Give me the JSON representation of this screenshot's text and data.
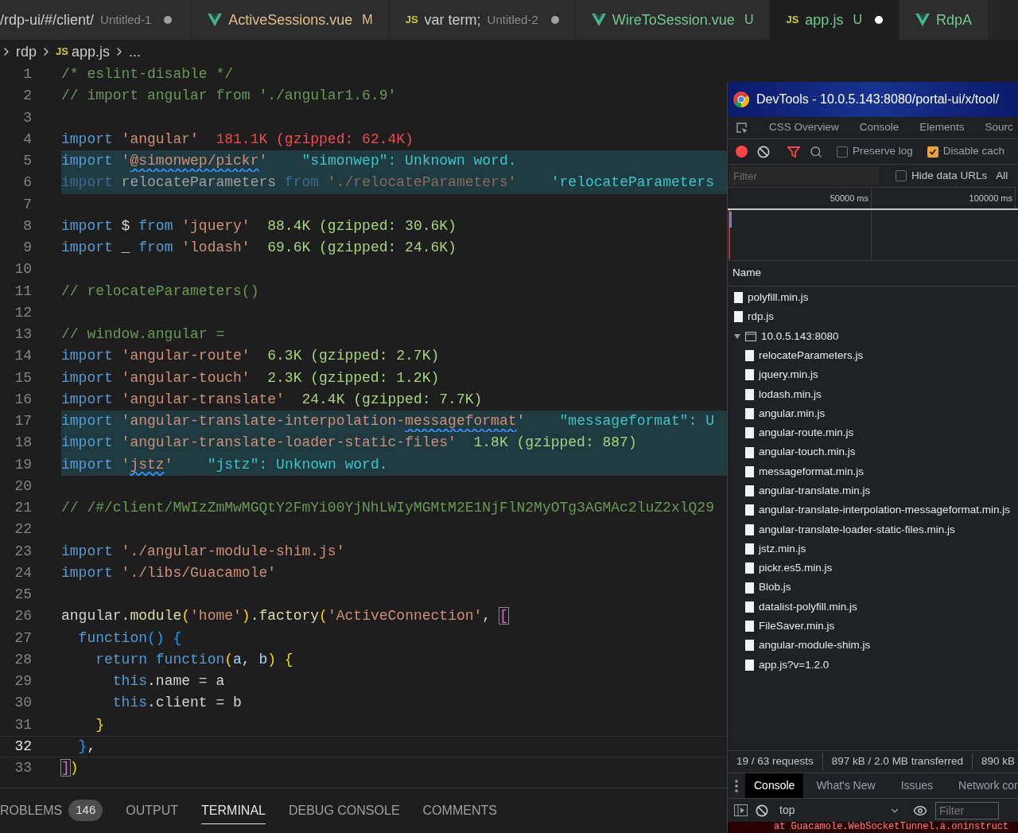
{
  "editor_tabs": [
    {
      "kind": "plain",
      "label": "/rdp-ui/#/client/",
      "detail": "Untitled-1",
      "dirty": true,
      "selected": false,
      "color": "#cccccc"
    },
    {
      "kind": "vue",
      "label": "ActiveSessions.vue",
      "status": "M",
      "dirty": false,
      "selected": false,
      "color": "#e2c08d"
    },
    {
      "kind": "js",
      "icon_text": "JS",
      "label": "var term;",
      "detail": "Untitled-2",
      "dirty": true,
      "selected": false,
      "color": "#cccccc"
    },
    {
      "kind": "vue",
      "label": "WireToSession.vue",
      "status": "U",
      "dirty": false,
      "selected": false,
      "color": "#73c991"
    },
    {
      "kind": "js",
      "icon_text": "JS",
      "label": "app.js",
      "status": "U",
      "dirty": true,
      "selected": true,
      "color": "#73c991"
    },
    {
      "kind": "vue",
      "label": "RdpA",
      "dirty": false,
      "selected": false,
      "color": "#73c991"
    }
  ],
  "breadcrumbs": [
    {
      "text": "rdp"
    },
    {
      "icon_text": "JS",
      "text": "app.js"
    },
    {
      "text": "..."
    }
  ],
  "code_lines": [
    {
      "number": "1",
      "highlighted": false,
      "current": false,
      "tokens": [
        {
          "kind": "cm",
          "text": "/* eslint-disable */"
        }
      ]
    },
    {
      "number": "2",
      "highlighted": false,
      "current": false,
      "tokens": [
        {
          "kind": "cm",
          "text": "// import angular from './angular1.6.9'"
        }
      ]
    },
    {
      "number": "3",
      "highlighted": false,
      "current": false
    },
    {
      "number": "4",
      "highlighted": false,
      "current": false,
      "tokens": [
        {
          "kind": "kw",
          "text": "import"
        },
        {
          "kind": "str",
          "text": " 'angular'"
        },
        {
          "kind": "warn",
          "text": "  181.1K (gzipped: 62.4K)"
        }
      ]
    },
    {
      "number": "5",
      "highlighted": true,
      "current": false,
      "tokens": [
        {
          "kind": "kw",
          "text": "import"
        },
        {
          "kind": "str",
          "text": " '"
        },
        {
          "kind": "str",
          "text": "@simonwep/pickr",
          "squiggle": true
        },
        {
          "kind": "str",
          "text": "'"
        },
        {
          "kind": "hint",
          "text": "    \"simonwep\": Unknown word."
        }
      ]
    },
    {
      "number": "6",
      "highlighted": true,
      "current": false,
      "tokens": [
        {
          "kind": "kw_dim",
          "text": "import"
        },
        {
          "kind": "plain_dim",
          "text": " relocateParameters"
        },
        {
          "kind": "kw_dim",
          "text": " from"
        },
        {
          "kind": "str_dim",
          "text": " './relocateParameters'"
        },
        {
          "kind": "hint",
          "text": "    'relocateParameters"
        }
      ]
    },
    {
      "number": "7",
      "highlighted": false,
      "current": false
    },
    {
      "number": "8",
      "highlighted": false,
      "current": false,
      "tokens": [
        {
          "kind": "kw",
          "text": "import"
        },
        {
          "kind": "plain",
          "text": " $"
        },
        {
          "kind": "kw",
          "text": " from"
        },
        {
          "kind": "str",
          "text": " 'jquery'"
        },
        {
          "kind": "size",
          "text": "  88.4K (gzipped: 30.6K)"
        }
      ]
    },
    {
      "number": "9",
      "highlighted": false,
      "current": false,
      "tokens": [
        {
          "kind": "kw",
          "text": "import"
        },
        {
          "kind": "plain",
          "text": " _"
        },
        {
          "kind": "kw",
          "text": " from"
        },
        {
          "kind": "str",
          "text": " 'lodash'"
        },
        {
          "kind": "size",
          "text": "  69.6K (gzipped: 24.6K)"
        }
      ]
    },
    {
      "number": "10",
      "highlighted": false,
      "current": false
    },
    {
      "number": "11",
      "highlighted": false,
      "current": false,
      "tokens": [
        {
          "kind": "cm",
          "text": "// relocateParameters()"
        }
      ]
    },
    {
      "number": "12",
      "highlighted": false,
      "current": false
    },
    {
      "number": "13",
      "highlighted": false,
      "current": false,
      "tokens": [
        {
          "kind": "cm",
          "text": "// window.angular ="
        }
      ]
    },
    {
      "number": "14",
      "highlighted": false,
      "current": false,
      "tokens": [
        {
          "kind": "kw",
          "text": "import"
        },
        {
          "kind": "str",
          "text": " 'angular-route'"
        },
        {
          "kind": "size",
          "text": "  6.3K (gzipped: 2.7K)"
        }
      ]
    },
    {
      "number": "15",
      "highlighted": false,
      "current": false,
      "tokens": [
        {
          "kind": "kw",
          "text": "import"
        },
        {
          "kind": "str",
          "text": " 'angular-touch'"
        },
        {
          "kind": "size",
          "text": "  2.3K (gzipped: 1.2K)"
        }
      ]
    },
    {
      "number": "16",
      "highlighted": false,
      "current": false,
      "tokens": [
        {
          "kind": "kw",
          "text": "import"
        },
        {
          "kind": "str",
          "text": " 'angular-translate'"
        },
        {
          "kind": "size",
          "text": "  24.4K (gzipped: 7.7K)"
        }
      ]
    },
    {
      "number": "17",
      "highlighted": true,
      "current": false,
      "tokens": [
        {
          "kind": "kw",
          "text": "import"
        },
        {
          "kind": "str",
          "text": " 'angular-translate-interpolation-"
        },
        {
          "kind": "str",
          "text": "messageformat",
          "squiggle": true
        },
        {
          "kind": "str",
          "text": "'"
        },
        {
          "kind": "hint",
          "text": "    \"messageformat\": U"
        }
      ]
    },
    {
      "number": "18",
      "highlighted": true,
      "current": false,
      "tokens": [
        {
          "kind": "kw",
          "text": "import"
        },
        {
          "kind": "str",
          "text": " 'angular-translate-loader-static-files'"
        },
        {
          "kind": "size",
          "text": "  1.8K (gzipped: 887)"
        }
      ]
    },
    {
      "number": "19",
      "highlighted": true,
      "current": false,
      "tokens": [
        {
          "kind": "kw",
          "text": "import"
        },
        {
          "kind": "str",
          "text": " '"
        },
        {
          "kind": "str",
          "text": "jstz",
          "squiggle": true
        },
        {
          "kind": "str",
          "text": "'"
        },
        {
          "kind": "hint",
          "text": "    \"jstz\": Unknown word."
        }
      ]
    },
    {
      "number": "20",
      "highlighted": false,
      "current": false
    },
    {
      "number": "21",
      "highlighted": false,
      "current": false,
      "tokens": [
        {
          "kind": "cm",
          "text": "// /#/client/MWIzZmMwMGQtY2FmYi00YjNhLWIyMGMtM2E1NjFlN2MyOTg3AGMAc2luZ2xlQ29"
        }
      ]
    },
    {
      "number": "22",
      "highlighted": false,
      "current": false
    },
    {
      "number": "23",
      "highlighted": false,
      "current": false,
      "tokens": [
        {
          "kind": "kw",
          "text": "import"
        },
        {
          "kind": "str",
          "text": " './angular-module-shim.js'"
        }
      ]
    },
    {
      "number": "24",
      "highlighted": false,
      "current": false,
      "tokens": [
        {
          "kind": "kw",
          "text": "import"
        },
        {
          "kind": "str",
          "text": " './libs/Guacamole'"
        }
      ]
    },
    {
      "number": "25",
      "highlighted": false,
      "current": false
    },
    {
      "number": "26",
      "highlighted": false,
      "current": false,
      "tokens": [
        {
          "kind": "plain",
          "text": "angular."
        },
        {
          "kind": "fn",
          "text": "module"
        },
        {
          "kind": "b1",
          "text": "("
        },
        {
          "kind": "str",
          "text": "'home'"
        },
        {
          "kind": "b1",
          "text": ")"
        },
        {
          "kind": "plain",
          "text": "."
        },
        {
          "kind": "fn",
          "text": "factory"
        },
        {
          "kind": "b1",
          "text": "("
        },
        {
          "kind": "str",
          "text": "'ActiveConnection'"
        },
        {
          "kind": "plain",
          "text": ", "
        },
        {
          "kind": "b2",
          "text": "[",
          "boxed": true
        }
      ]
    },
    {
      "number": "27",
      "highlighted": false,
      "current": false,
      "tokens": [
        {
          "kind": "kw",
          "text": "  function"
        },
        {
          "kind": "b3",
          "text": "() {"
        }
      ]
    },
    {
      "number": "28",
      "highlighted": false,
      "current": false,
      "tokens": [
        {
          "kind": "kw",
          "text": "    return function"
        },
        {
          "kind": "b1",
          "text": "("
        },
        {
          "kind": "var",
          "text": "a, b"
        },
        {
          "kind": "b1",
          "text": ") {"
        }
      ]
    },
    {
      "number": "29",
      "highlighted": false,
      "current": false,
      "tokens": [
        {
          "kind": "kw",
          "text": "      this"
        },
        {
          "kind": "plain",
          "text": ".name = a"
        }
      ]
    },
    {
      "number": "30",
      "highlighted": false,
      "current": false,
      "tokens": [
        {
          "kind": "kw",
          "text": "      this"
        },
        {
          "kind": "plain",
          "text": ".client = b"
        }
      ]
    },
    {
      "number": "31",
      "highlighted": false,
      "current": false,
      "tokens": [
        {
          "kind": "b1",
          "text": "    }"
        }
      ]
    },
    {
      "number": "32",
      "highlighted": false,
      "current": true,
      "tokens": [
        {
          "kind": "b3",
          "text": "  }"
        },
        {
          "kind": "plain",
          "text": ","
        }
      ]
    },
    {
      "number": "33",
      "highlighted": false,
      "current": false,
      "tokens": [
        {
          "kind": "b2",
          "text": "]",
          "boxed": true
        },
        {
          "kind": "b1",
          "text": ")"
        }
      ]
    }
  ],
  "panel_tabs": [
    {
      "label": "ROBLEMS",
      "badge": "146",
      "selected": false
    },
    {
      "label": "OUTPUT",
      "selected": false
    },
    {
      "label": "TERMINAL",
      "selected": true
    },
    {
      "label": "DEBUG CONSOLE",
      "selected": false
    },
    {
      "label": "COMMENTS",
      "selected": false
    }
  ],
  "devtools": {
    "title": "DevTools - 10.0.5.143:8080/portal-ui/x/tool/",
    "tabs": [
      {
        "label": "CSS Overview",
        "selected": false
      },
      {
        "label": "Console",
        "selected": false
      },
      {
        "label": "Elements",
        "selected": false
      },
      {
        "label": "Sourc",
        "selected": false
      }
    ],
    "recording": true,
    "filter_active": true,
    "checkboxes": [
      {
        "label": "Preserve log",
        "checked": false
      },
      {
        "label": "Disable cach",
        "checked": true
      }
    ],
    "filter": {
      "placeholder": "Filter",
      "hide_data_urls": {
        "label": "Hide data URLs",
        "checked": false
      },
      "type_button": "All"
    },
    "timeline": {
      "ticks": [
        "50000 ms",
        "100000 ms"
      ]
    },
    "requests": {
      "column": "Name",
      "items": [
        {
          "kind": "file",
          "name": "polyfill.min.js"
        },
        {
          "kind": "file",
          "name": "rdp.js"
        },
        {
          "kind": "frame",
          "name": "10.0.5.143:8080",
          "expanded": true,
          "children": [
            {
              "kind": "file",
              "name": "relocateParameters.js"
            },
            {
              "kind": "file",
              "name": "jquery.min.js"
            },
            {
              "kind": "file",
              "name": "lodash.min.js"
            },
            {
              "kind": "file",
              "name": "angular.min.js"
            },
            {
              "kind": "file",
              "name": "angular-route.min.js"
            },
            {
              "kind": "file",
              "name": "angular-touch.min.js"
            },
            {
              "kind": "file",
              "name": "messageformat.min.js"
            },
            {
              "kind": "file",
              "name": "angular-translate.min.js"
            },
            {
              "kind": "file",
              "name": "angular-translate-interpolation-messageformat.min.js"
            },
            {
              "kind": "file",
              "name": "angular-translate-loader-static-files.min.js"
            },
            {
              "kind": "file",
              "name": "jstz.min.js"
            },
            {
              "kind": "file",
              "name": "pickr.es5.min.js"
            },
            {
              "kind": "file",
              "name": "Blob.js"
            },
            {
              "kind": "file",
              "name": "datalist-polyfill.min.js"
            },
            {
              "kind": "file",
              "name": "FileSaver.min.js"
            },
            {
              "kind": "file",
              "name": "angular-module-shim.js"
            },
            {
              "kind": "file",
              "name": "app.js?v=1.2.0"
            }
          ]
        }
      ]
    },
    "summary": [
      "19 / 63 requests",
      "897 kB / 2.0 MB transferred",
      "890 kB"
    ],
    "drawer": {
      "tabs": [
        {
          "label": "Console",
          "selected": true
        },
        {
          "label": "What's New",
          "selected": false
        },
        {
          "label": "Issues",
          "selected": false
        },
        {
          "label": "Network cor",
          "selected": false
        }
      ],
      "context": "top",
      "filter_placeholder": "Filter",
      "message": "at Guacamole.WebSocketTunnel.a.oninstruct"
    }
  }
}
